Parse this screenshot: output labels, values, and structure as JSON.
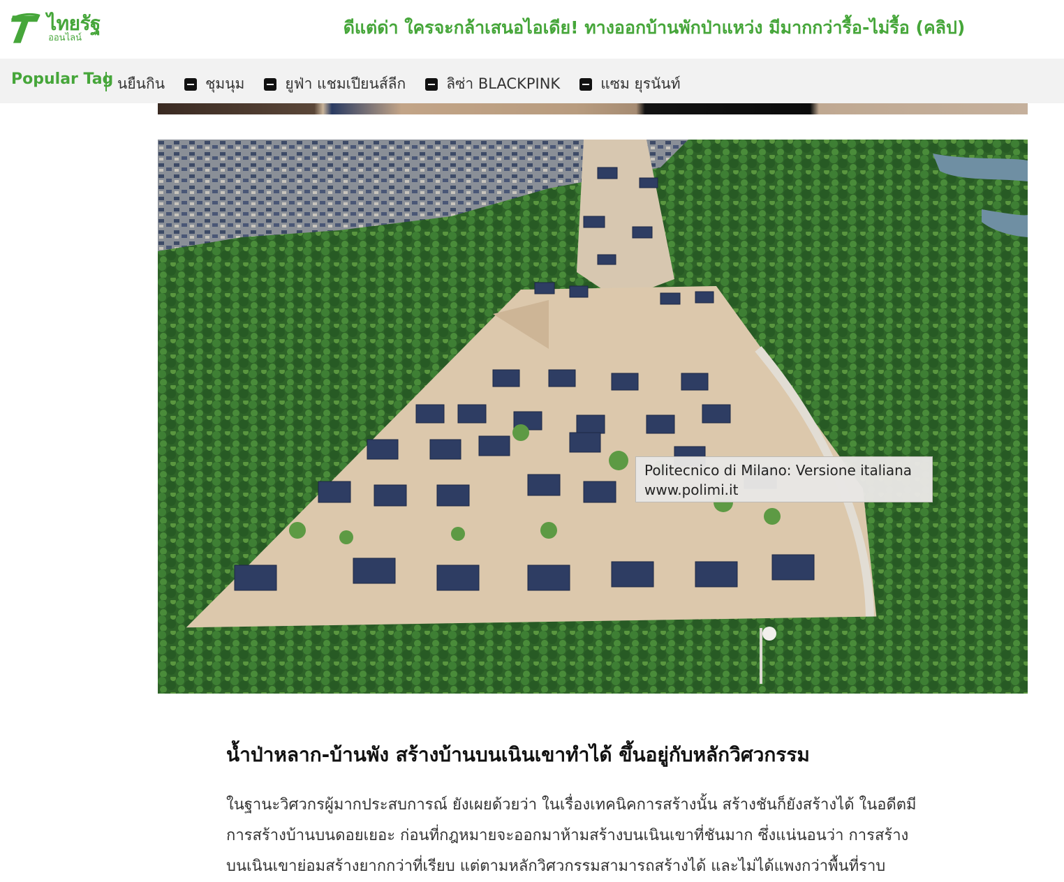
{
  "header": {
    "logo": {
      "name": "ไทยรัฐ",
      "sub": "ออนไลน์",
      "icon": "thairath-logo-icon",
      "color": "#46a63a"
    },
    "headline": "ดีแต่ด่า ใครจะกล้าเสนอไอเดีย! ทางออกบ้านพักป่าแหว่ง มีมากกว่ารื้อ-ไม่รื้อ (คลิป)"
  },
  "tagbar": {
    "title": "Popular Tag",
    "tags": [
      {
        "label": "นยืนกิน",
        "icon": ""
      },
      {
        "label": "ชุมนุม",
        "icon": "tag-icon"
      },
      {
        "label": "ยูฟ่า แชมเปียนส์ลีก",
        "icon": "tag-icon"
      },
      {
        "label": "ลิซ่า BLACKPINK",
        "icon": "tag-icon"
      },
      {
        "label": "แซม ยุรนันท์",
        "icon": "tag-icon"
      }
    ]
  },
  "photo": {
    "tooltip_line1": "Politecnico di Milano: Versione italiana",
    "tooltip_line2": "www.polimi.it"
  },
  "article": {
    "heading": "น้ำป่าหลาก-บ้านพัง สร้างบ้านบนเนินเขาทำได้ ขึ้นอยู่กับหลักวิศวกรรม",
    "paragraph_lines": [
      "ในฐานะวิศวกรผู้มากประสบการณ์ ยังเผยด้วยว่า ในเรื่องเทคนิคการสร้างนั้น สร้างชันก็ยังสร้างได้ ในอดีตมี",
      "การสร้างบ้านบนดอยเยอะ ก่อนที่กฎหมายจะออกมาห้ามสร้างบนเนินเขาที่ชันมาก ซึ่งแน่นอนว่า การสร้าง",
      "บนเนินเขาย่อมสร้างยากกว่าที่เรียบ แต่ตามหลักวิศวกรรมสามารถสร้างได้ และไม่ได้แพงกว่าพื้นที่ราบ"
    ]
  },
  "colors": {
    "brand_green": "#46a63a",
    "tagbar_bg": "#f2f2f2"
  }
}
